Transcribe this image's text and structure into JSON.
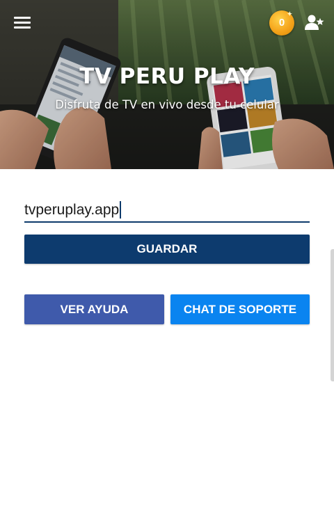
{
  "header": {
    "title": "TV PERU PLAY",
    "subtitle": "Disfruta de TV en vivo desde tu celular",
    "coin_count": "0",
    "icons": {
      "menu": "menu-icon",
      "coins": "coin-icon",
      "user": "user-star-icon"
    }
  },
  "form": {
    "url_value": "tvperuplay.app",
    "save_label": "GUARDAR"
  },
  "actions": {
    "help_label": "VER AYUDA",
    "chat_label": "CHAT DE SOPORTE"
  },
  "colors": {
    "save_button": "#0d3b6e",
    "help_button": "#3f5aab",
    "chat_button": "#0a84f0",
    "coin": "#f5a41b",
    "input_underline": "#0d3a6b"
  }
}
